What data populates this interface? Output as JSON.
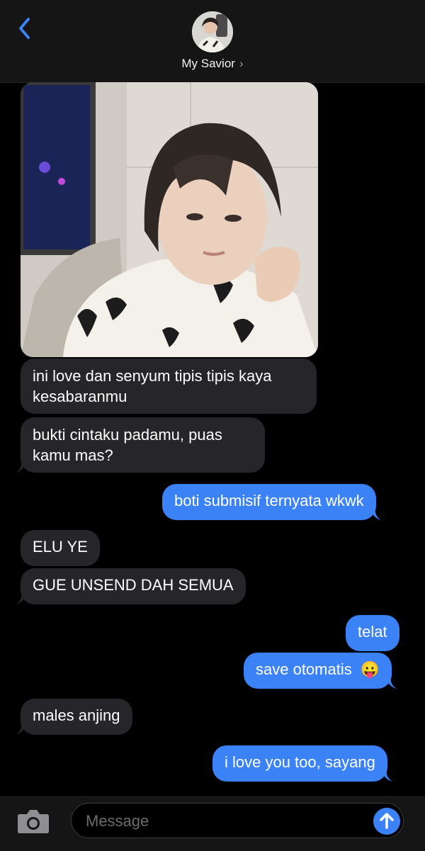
{
  "header": {
    "contact_name": "My Savior",
    "chevron": "›",
    "back_icon": "chevron-left-icon"
  },
  "messages": [
    {
      "direction": "incoming",
      "type": "image",
      "alt": "photo-attachment"
    },
    {
      "direction": "incoming",
      "line1": "ini love dan senyum tipis tipis kaya",
      "line2": "kesabaranmu"
    },
    {
      "direction": "incoming",
      "line1": "bukti cintaku padamu, puas",
      "line2": "kamu mas?"
    },
    {
      "direction": "outgoing",
      "text": "boti submisif ternyata wkwk"
    },
    {
      "direction": "incoming",
      "text": "ELU YE"
    },
    {
      "direction": "incoming",
      "text": "GUE UNSEND DAH SEMUA"
    },
    {
      "direction": "outgoing",
      "text": "telat"
    },
    {
      "direction": "outgoing",
      "text": "save otomatis",
      "emoji": "😛"
    },
    {
      "direction": "incoming",
      "text": "males anjing"
    },
    {
      "direction": "outgoing",
      "text": "i love you too, sayang"
    }
  ],
  "composer": {
    "placeholder": "Message",
    "camera_icon": "camera-icon",
    "send_icon": "arrow-up-icon"
  },
  "colors": {
    "incoming_bubble": "#26252a",
    "outgoing_bubble": "#3b82f6",
    "background": "#000000"
  }
}
